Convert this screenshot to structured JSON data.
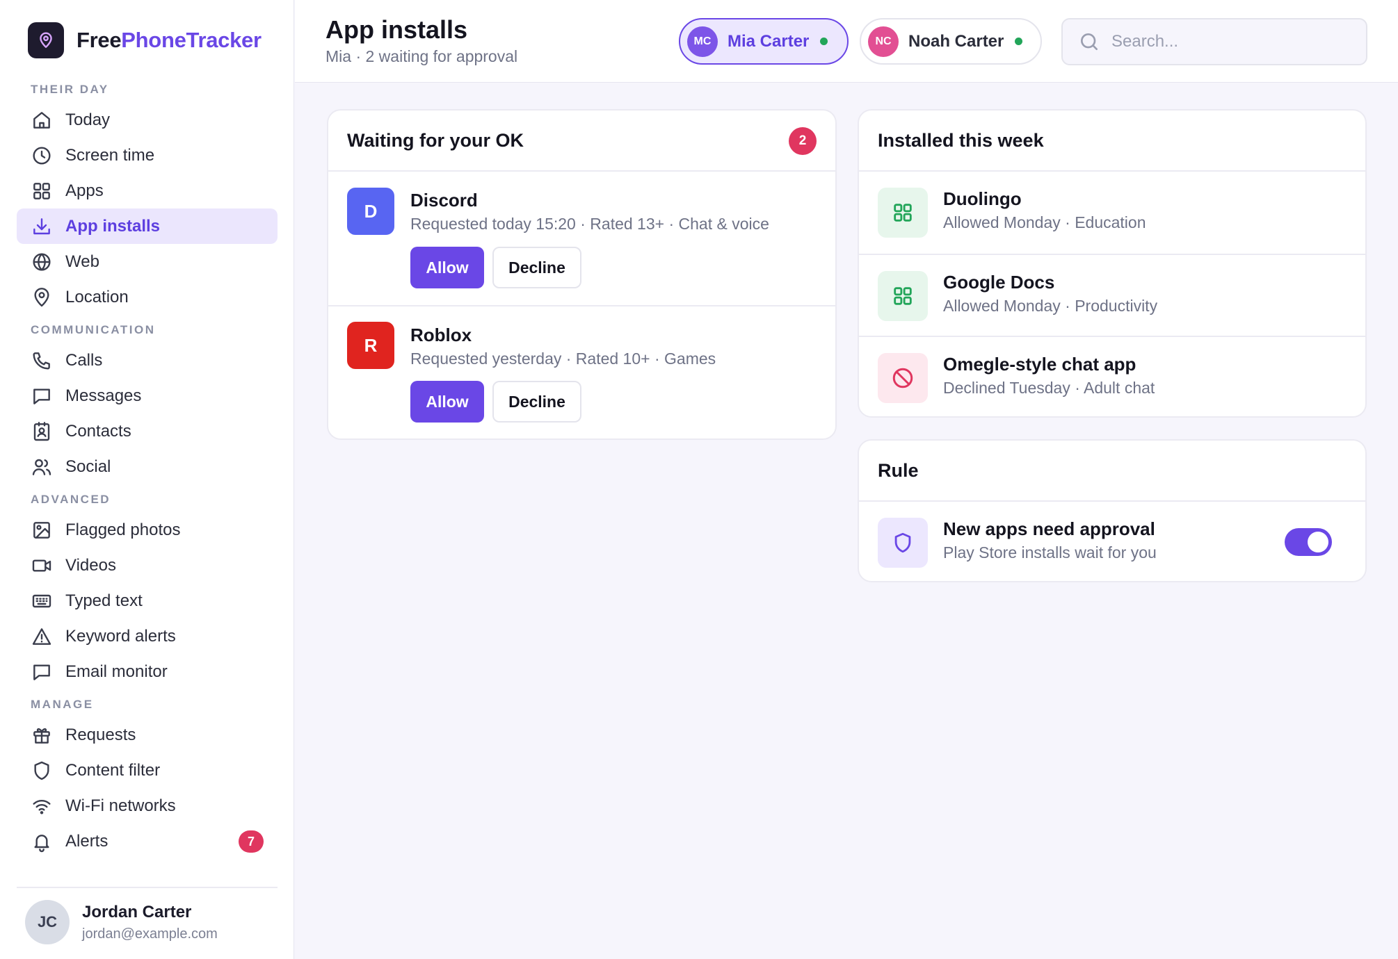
{
  "brand": {
    "name_part1": "Free",
    "name_part2": "PhoneTracker",
    "logo_icon": "pin-icon"
  },
  "sidebar": {
    "sections": [
      {
        "label": "THEIR DAY",
        "items": [
          {
            "label": "Today",
            "icon": "home-icon"
          },
          {
            "label": "Screen time",
            "icon": "clock-icon"
          },
          {
            "label": "Apps",
            "icon": "grid-icon"
          },
          {
            "label": "App installs",
            "icon": "download-icon",
            "active": true
          },
          {
            "label": "Web",
            "icon": "globe-icon"
          },
          {
            "label": "Location",
            "icon": "pin-icon"
          }
        ]
      },
      {
        "label": "COMMUNICATION",
        "items": [
          {
            "label": "Calls",
            "icon": "phone-icon"
          },
          {
            "label": "Messages",
            "icon": "message-icon"
          },
          {
            "label": "Contacts",
            "icon": "contact-card-icon"
          },
          {
            "label": "Social",
            "icon": "users-icon"
          }
        ]
      },
      {
        "label": "ADVANCED",
        "items": [
          {
            "label": "Flagged photos",
            "icon": "image-icon"
          },
          {
            "label": "Videos",
            "icon": "video-icon"
          },
          {
            "label": "Typed text",
            "icon": "keyboard-icon"
          },
          {
            "label": "Keyword alerts",
            "icon": "warning-icon"
          },
          {
            "label": "Email monitor",
            "icon": "message-icon"
          }
        ]
      },
      {
        "label": "MANAGE",
        "items": [
          {
            "label": "Requests",
            "icon": "gift-icon"
          },
          {
            "label": "Content filter",
            "icon": "shield-icon"
          },
          {
            "label": "Wi-Fi networks",
            "icon": "wifi-icon"
          },
          {
            "label": "Alerts",
            "icon": "bell-icon",
            "badge": "7"
          }
        ]
      }
    ],
    "user": {
      "initials": "JC",
      "name": "Jordan Carter",
      "email": "jordan@example.com"
    }
  },
  "header": {
    "title": "App installs",
    "subtitle": "Mia · 2 waiting for approval",
    "children": [
      {
        "initials": "MC",
        "name": "Mia Carter",
        "selected": true
      },
      {
        "initials": "NC",
        "name": "Noah Carter",
        "selected": false
      }
    ],
    "search_placeholder": "Search..."
  },
  "pending": {
    "title": "Waiting for your OK",
    "count": "2",
    "requests": [
      {
        "letter": "D",
        "name": "Discord",
        "meta": "Requested today 15:20 · Rated 13+ · Chat & voice",
        "color": "#5865f2",
        "allow": "Allow",
        "decline": "Decline"
      },
      {
        "letter": "R",
        "name": "Roblox",
        "meta": "Requested yesterday · Rated 10+ · Games",
        "color": "#e0241f",
        "allow": "Allow",
        "decline": "Decline"
      }
    ]
  },
  "installed": {
    "title": "Installed this week",
    "items": [
      {
        "name": "Duolingo",
        "meta": "Allowed Monday · Education",
        "icon": "grid-icon",
        "status": "allowed"
      },
      {
        "name": "Google Docs",
        "meta": "Allowed Monday · Productivity",
        "icon": "grid-icon",
        "status": "allowed"
      },
      {
        "name": "Omegle-style chat app",
        "meta": "Declined Tuesday · Adult chat",
        "icon": "blocked-icon",
        "status": "declined"
      }
    ]
  },
  "rule": {
    "title": "Rule",
    "name": "New apps need approval",
    "description": "Play Store installs wait for you",
    "icon": "shield-icon",
    "enabled": true
  },
  "colors": {
    "accent": "#6a47e6",
    "badge": "#e0365f",
    "online": "#22a559",
    "allowed_tile": "#e7f6ec",
    "allowed_icon": "#22a559",
    "declined_tile": "#fde8ee",
    "declined_icon": "#e0365f",
    "rule_tile": "#ece7fe"
  }
}
